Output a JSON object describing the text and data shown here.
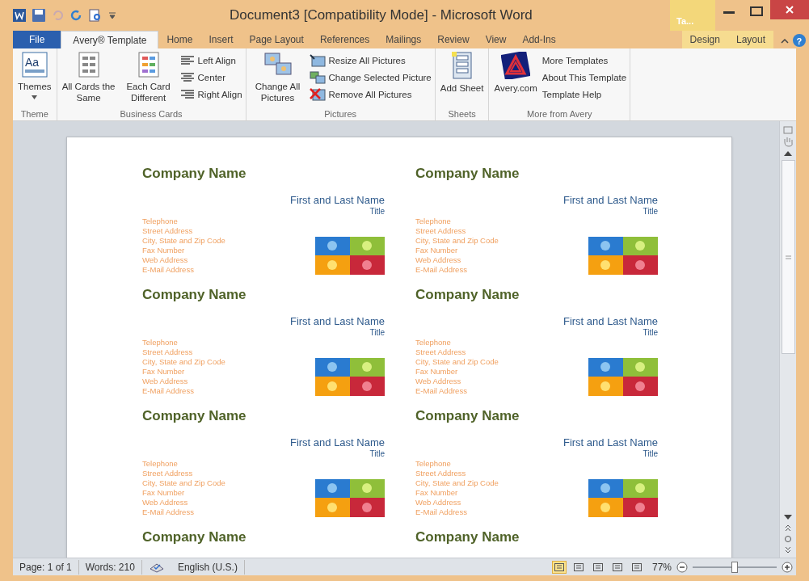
{
  "window": {
    "title": "Document3 [Compatibility Mode] - Microsoft Word",
    "contextual_tab_header": "Ta...",
    "help_mark": "?"
  },
  "tabs": [
    {
      "label": "File",
      "kind": "file",
      "selected": false
    },
    {
      "label": "Avery® Template",
      "kind": "tab",
      "selected": true
    },
    {
      "label": "Home",
      "kind": "tab",
      "selected": false
    },
    {
      "label": "Insert",
      "kind": "tab",
      "selected": false
    },
    {
      "label": "Page Layout",
      "kind": "tab",
      "selected": false
    },
    {
      "label": "References",
      "kind": "tab",
      "selected": false
    },
    {
      "label": "Mailings",
      "kind": "tab",
      "selected": false
    },
    {
      "label": "Review",
      "kind": "tab",
      "selected": false
    },
    {
      "label": "View",
      "kind": "tab",
      "selected": false
    },
    {
      "label": "Add-Ins",
      "kind": "tab",
      "selected": false
    },
    {
      "label": "Design",
      "kind": "contextual",
      "selected": false
    },
    {
      "label": "Layout",
      "kind": "contextual",
      "selected": false
    }
  ],
  "ribbon": {
    "groups": [
      {
        "label": "Theme",
        "items": [
          {
            "kind": "large",
            "label": "Themes",
            "icon_text": "Aa",
            "dropdown": true
          }
        ]
      },
      {
        "label": "Business Cards",
        "items": [
          {
            "kind": "large",
            "label": "All Cards the Same"
          },
          {
            "kind": "large",
            "label": "Each Card Different"
          },
          {
            "kind": "stack",
            "entries": [
              {
                "label": "Left Align"
              },
              {
                "label": "Center"
              },
              {
                "label": "Right Align"
              }
            ]
          }
        ]
      },
      {
        "label": "Pictures",
        "items": [
          {
            "kind": "large",
            "label": "Change All Pictures"
          },
          {
            "kind": "stack",
            "entries": [
              {
                "label": "Resize All Pictures"
              },
              {
                "label": "Change Selected Picture"
              },
              {
                "label": "Remove All Pictures"
              }
            ]
          }
        ]
      },
      {
        "label": "Sheets",
        "items": [
          {
            "kind": "large",
            "label": "Add Sheet"
          }
        ]
      },
      {
        "label": "More from Avery",
        "items": [
          {
            "kind": "large",
            "label": "Avery.com"
          },
          {
            "kind": "stack",
            "entries": [
              {
                "label": "More Templates"
              },
              {
                "label": "About This Template"
              },
              {
                "label": "Template Help"
              }
            ]
          }
        ]
      }
    ]
  },
  "cards": [
    {
      "company": "Company Name",
      "name": "First and Last Name",
      "title": "Title",
      "lines": [
        "Telephone",
        "Street Address",
        "City, State and Zip Code",
        "Fax Number",
        "Web Address",
        "E-Mail Address"
      ]
    },
    {
      "company": "Company Name",
      "name": "First and Last Name",
      "title": "Title",
      "lines": [
        "Telephone",
        "Street Address",
        "City, State and Zip Code",
        "Fax Number",
        "Web Address",
        "E-Mail Address"
      ]
    },
    {
      "company": "Company Name",
      "name": "First and Last Name",
      "title": "Title",
      "lines": [
        "Telephone",
        "Street Address",
        "City, State and Zip Code",
        "Fax Number",
        "Web Address",
        "E-Mail Address"
      ]
    },
    {
      "company": "Company Name",
      "name": "First and Last Name",
      "title": "Title",
      "lines": [
        "Telephone",
        "Street Address",
        "City, State and Zip Code",
        "Fax Number",
        "Web Address",
        "E-Mail Address"
      ]
    },
    {
      "company": "Company Name",
      "name": "First and Last Name",
      "title": "Title",
      "lines": [
        "Telephone",
        "Street Address",
        "City, State and Zip Code",
        "Fax Number",
        "Web Address",
        "E-Mail Address"
      ]
    },
    {
      "company": "Company Name",
      "name": "First and Last Name",
      "title": "Title",
      "lines": [
        "Telephone",
        "Street Address",
        "City, State and Zip Code",
        "Fax Number",
        "Web Address",
        "E-Mail Address"
      ]
    },
    {
      "company": "Company Name"
    },
    {
      "company": "Company Name"
    }
  ],
  "status_bar": {
    "page": "Page: 1 of 1",
    "words": "Words: 210",
    "language": "English (U.S.)",
    "zoom": "77%",
    "zoom_slider": {
      "level": 0.5
    },
    "views": [
      {
        "selected": true
      },
      {
        "selected": false
      },
      {
        "selected": false
      },
      {
        "selected": false
      },
      {
        "selected": false
      }
    ]
  }
}
